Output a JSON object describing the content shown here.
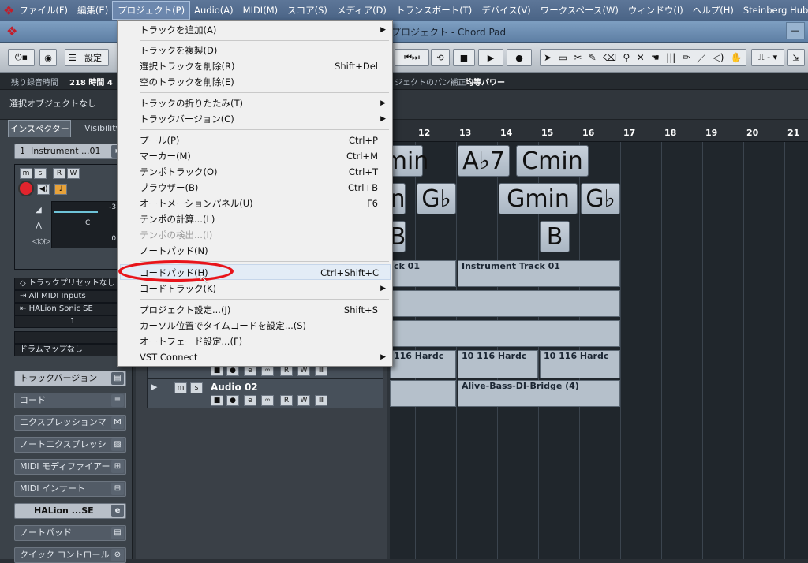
{
  "menubar": {
    "items": [
      "ファイル(F)",
      "編集(E)",
      "プロジェクト(P)",
      "Audio(A)",
      "MIDI(M)",
      "スコア(S)",
      "メディア(D)",
      "トランスポート(T)",
      "デバイス(V)",
      "ワークスペース(W)",
      "ウィンドウ(I)",
      "ヘルプ(H)",
      "Steinberg Hub(N)"
    ],
    "active_index": 2
  },
  "window": {
    "title": "プロジェクト - Chord Pad",
    "title_prefix": "プロジェクト",
    "title_suffix": " - Chord Pad"
  },
  "toolbar": {
    "settings_label": "設定",
    "transport_icons": [
      "rewind-icon",
      "forward-icon",
      "cycle-icon",
      "stop-icon",
      "play-icon",
      "record-icon"
    ],
    "tool_icons": [
      "pointer-icon",
      "range-icon",
      "split-icon",
      "glue-icon",
      "erase-icon",
      "zoom-icon",
      "mute-icon",
      "time-warp-icon",
      "comp-icon",
      "draw-icon",
      "line-icon",
      "play-tool-icon",
      "color-icon"
    ]
  },
  "status": {
    "rec_time_label": "残り録音時間",
    "rec_time_value": "218 時間 4",
    "pan_label": "ジェクトのパン補正",
    "pan_value": "均等パワー"
  },
  "selection": {
    "text": "選択オブジェクトなし"
  },
  "inspector": {
    "tabs": [
      "インスペクター",
      "Visibility"
    ],
    "track_name": "Instrument ...01",
    "track_number": "1",
    "volume_value": "-3.",
    "pan_value": "C",
    "delay_value": "0.",
    "preset": "トラックプリセットなし",
    "input": "All MIDI Inputs",
    "output": "HALion Sonic SE",
    "channel": "1",
    "drummap": "ドラムマップなし",
    "sections": [
      "トラックバージョン",
      "コード",
      "エクスプレッションマ",
      "ノートエクスプレッシ",
      "MIDI モディファイアー",
      "MIDI インサート",
      "HALion ...SE",
      "ノートパッド",
      "クイック コントロール"
    ]
  },
  "ruler": {
    "bars": [
      "12",
      "13",
      "14",
      "15",
      "16",
      "17",
      "18",
      "19",
      "20",
      "21"
    ]
  },
  "chords": [
    {
      "text": "min"
    },
    {
      "text": "A♭7"
    },
    {
      "text": "Cmin"
    },
    {
      "text": "n"
    },
    {
      "text": "G♭"
    },
    {
      "text": "Gmin"
    },
    {
      "text": "G♭"
    },
    {
      "text": "B"
    },
    {
      "text": "B"
    }
  ],
  "events": {
    "instrument_a": "ck 01",
    "instrument_b": "Instrument Track 01",
    "audio1_a": "116 Hardc",
    "audio1_b": "10 116 Hardc",
    "audio1_c": "10 116 Hardc",
    "audio2": "Alive-Bass-DI-Bridge (4)"
  },
  "tracks": [
    {
      "name": "Audio 02"
    }
  ],
  "track_buttons": [
    "m",
    "s"
  ],
  "track_small_buttons": [
    "■",
    "●",
    "e",
    "∞",
    "R",
    "W",
    "Ⅲ"
  ],
  "project_menu": {
    "items": [
      {
        "label": "トラックを追加(A)",
        "shortcut": "",
        "sub": true
      },
      {
        "label": "トラックを複製(D)",
        "shortcut": ""
      },
      {
        "label": "選択トラックを削除(R)",
        "shortcut": "Shift+Del"
      },
      {
        "label": "空のトラックを削除(E)",
        "shortcut": ""
      },
      {
        "label": "トラックの折りたたみ(T)",
        "shortcut": "",
        "sub": true
      },
      {
        "label": "トラックバージョン(C)",
        "shortcut": "",
        "sub": true
      },
      {
        "label": "プール(P)",
        "shortcut": "Ctrl+P"
      },
      {
        "label": "マーカー(M)",
        "shortcut": "Ctrl+M"
      },
      {
        "label": "テンポトラック(O)",
        "shortcut": "Ctrl+T"
      },
      {
        "label": "ブラウザー(B)",
        "shortcut": "Ctrl+B"
      },
      {
        "label": "オートメーションパネル(U)",
        "shortcut": "F6"
      },
      {
        "label": "テンポの計算...(L)",
        "shortcut": ""
      },
      {
        "label": "テンポの検出...(I)",
        "shortcut": "",
        "disabled": true
      },
      {
        "label": "ノートパッド(N)",
        "shortcut": ""
      },
      {
        "label": "コードパッド(H)",
        "shortcut": "Ctrl+Shift+C",
        "highlighted": true
      },
      {
        "label": "コードトラック(K)",
        "shortcut": "",
        "sub": true
      },
      {
        "label": "プロジェクト設定...(J)",
        "shortcut": "Shift+S"
      },
      {
        "label": "カーソル位置でタイムコードを設定...(S)",
        "shortcut": ""
      },
      {
        "label": "オートフェード設定...(F)",
        "shortcut": ""
      },
      {
        "label": "VST Connect",
        "shortcut": "",
        "sub": true
      }
    ]
  },
  "colors": {
    "menubar": "#5d7698",
    "highlight_ring": "#e8141b",
    "chord_fill": "#c9d2dc"
  }
}
